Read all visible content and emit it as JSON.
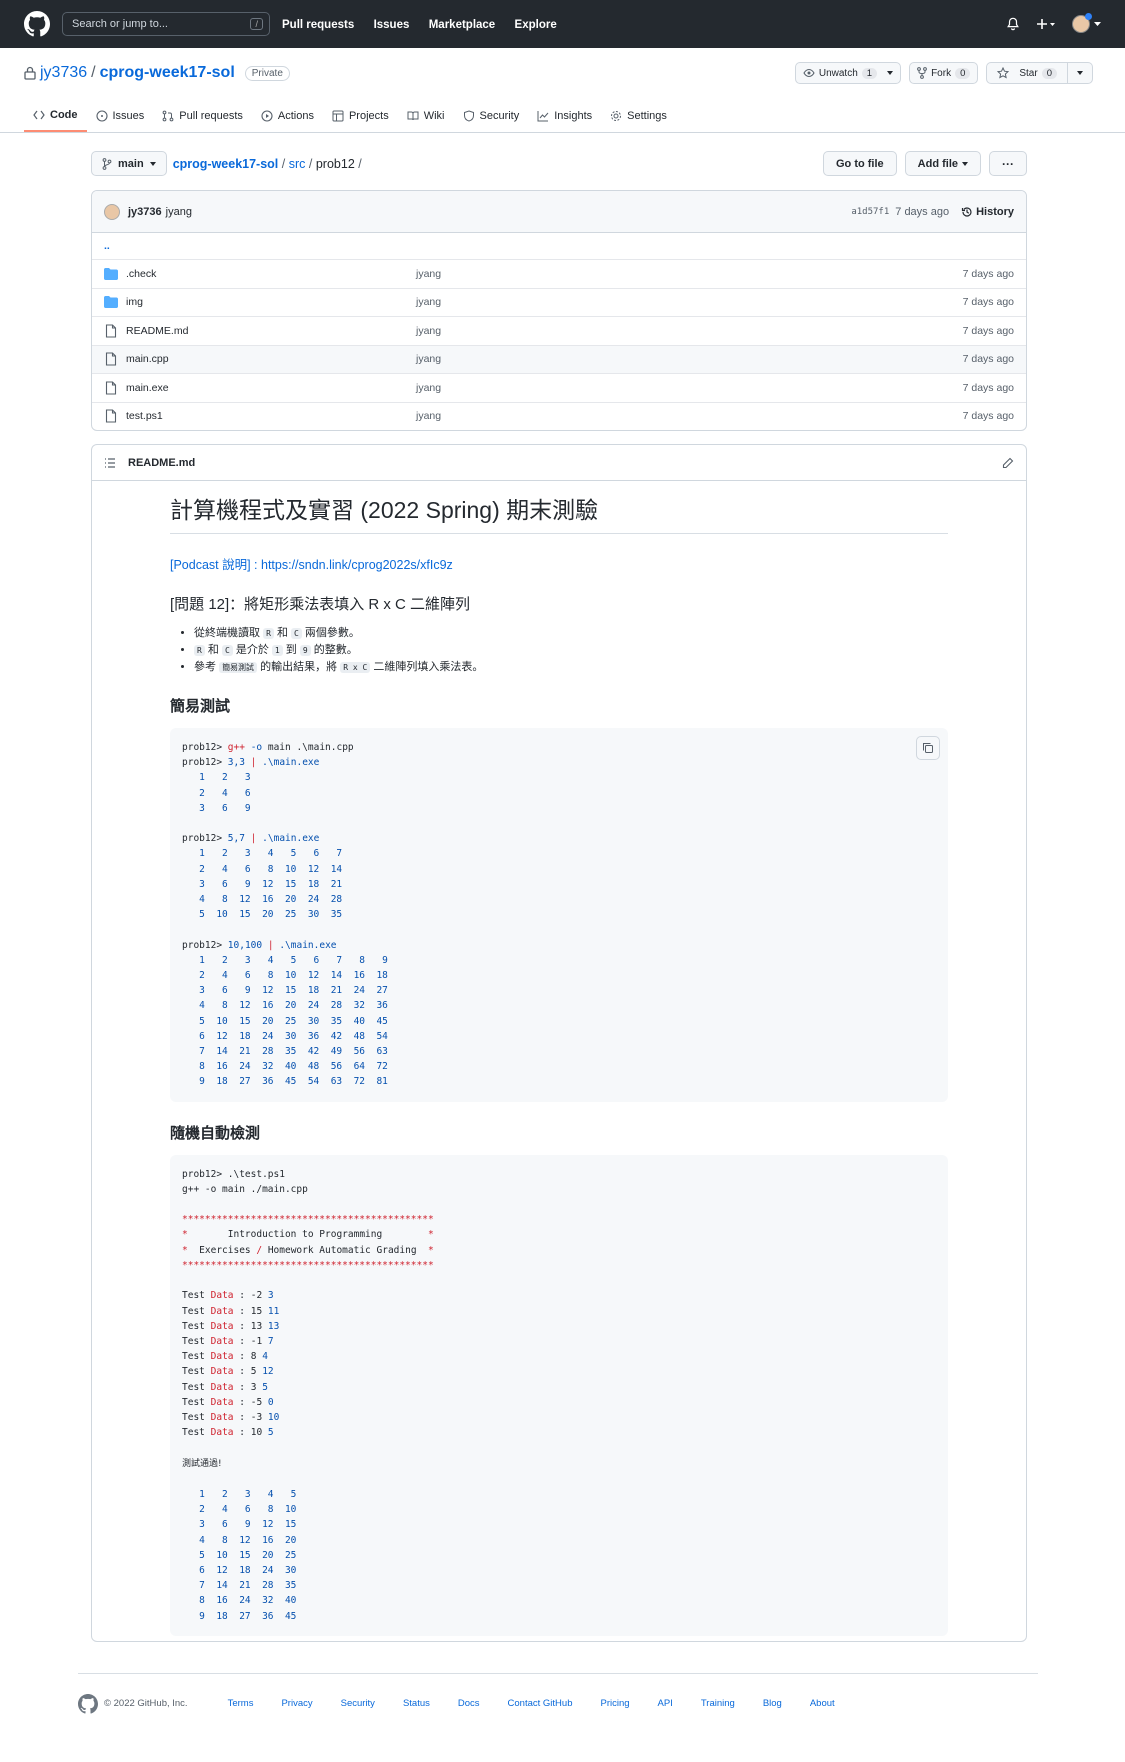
{
  "header": {
    "search_placeholder": "Search or jump to...",
    "slash_key": "/",
    "nav": [
      "Pull requests",
      "Issues",
      "Marketplace",
      "Explore"
    ]
  },
  "repo": {
    "owner": "jy3736",
    "separator": "/",
    "name": "cprog-week17-sol",
    "visibility": "Private",
    "unwatch_label": "Unwatch",
    "unwatch_count": "1",
    "fork_label": "Fork",
    "fork_count": "0",
    "star_label": "Star",
    "star_count": "0"
  },
  "tabs": [
    "Code",
    "Issues",
    "Pull requests",
    "Actions",
    "Projects",
    "Wiki",
    "Security",
    "Insights",
    "Settings"
  ],
  "path": {
    "branch": "main",
    "root": "cprog-week17-sol",
    "sep1": "/",
    "src": "src",
    "sep2": "/",
    "current": "prob12",
    "sep3": "/"
  },
  "buttons": {
    "go_to_file": "Go to file",
    "add_file": "Add file",
    "more": "···"
  },
  "commit": {
    "author": "jy3736",
    "committer": "jyang",
    "sha": "a1d57f1",
    "age": "7 days ago",
    "history": "History"
  },
  "files": {
    "parent": "..",
    "rows": [
      {
        "name": ".check",
        "type": "folder",
        "commit": "jyang",
        "age": "7 days ago"
      },
      {
        "name": "img",
        "type": "folder",
        "commit": "jyang",
        "age": "7 days ago"
      },
      {
        "name": "README.md",
        "type": "file",
        "commit": "jyang",
        "age": "7 days ago"
      },
      {
        "name": "main.cpp",
        "type": "file",
        "commit": "jyang",
        "age": "7 days ago"
      },
      {
        "name": "main.exe",
        "type": "file",
        "commit": "jyang",
        "age": "7 days ago"
      },
      {
        "name": "test.ps1",
        "type": "file",
        "commit": "jyang",
        "age": "7 days ago"
      }
    ]
  },
  "readme": {
    "filename": "README.md",
    "title": "計算機程式及實習 (2022 Spring) 期末測驗",
    "podcast": "[Podcast 說明] : https://sndn.link/cprog2022s/xfIc9z",
    "problem": "[問題 12]：將矩形乘法表填入 R x C 二維陣列",
    "bullet1": {
      "a": "從終端機讀取",
      "c1": "R",
      "b": "和",
      "c2": "C",
      "d": "兩個參數。"
    },
    "bullet2": {
      "c1": "R",
      "a": "和",
      "c2": "C",
      "b": "是介於",
      "c3": "1",
      "c": "到",
      "c4": "9",
      "d": "的整數。"
    },
    "bullet3": {
      "a": "參考",
      "c1": "簡易測試",
      "b": "的輸出結果，將",
      "c2": "R x C",
      "c": "二維陣列填入乘法表。"
    },
    "section1": "簡易測試",
    "section2": "隨機自動檢測"
  },
  "code1": {
    "prompt": "prob12>",
    "cmd1_rest": "g++ -o main .\\main.cpp",
    "runs": [
      {
        "args": "3,3",
        "pipe": "|",
        "exe": ".\\main.exe",
        "table": "   1   2   3\n   2   4   6\n   3   6   9"
      },
      {
        "args": "5,7",
        "pipe": "|",
        "exe": ".\\main.exe",
        "table": "   1   2   3   4   5   6   7\n   2   4   6   8  10  12  14\n   3   6   9  12  15  18  21\n   4   8  12  16  20  24  28\n   5  10  15  20  25  30  35"
      },
      {
        "args": "10,100",
        "pipe": "|",
        "exe": ".\\main.exe",
        "table": "   1   2   3   4   5   6   7   8   9\n   2   4   6   8  10  12  14  16  18\n   3   6   9  12  15  18  21  24  27\n   4   8  12  16  20  24  28  32  36\n   5  10  15  20  25  30  35  40  45\n   6  12  18  24  30  36  42  48  54\n   7  14  21  28  35  42  49  56  63\n   8  16  24  32  40  48  56  64  72\n   9  18  27  36  45  54  63  72  81"
      }
    ]
  },
  "code2": {
    "line1": "prob12> .\\test.ps1",
    "line2": "g++ -o main ./main.cpp",
    "banner_border": "********************************************",
    "banner_line1": "*       Introduction to Programming        *",
    "banner_line2a": "*  Exercises ",
    "banner_slash": "/",
    "banner_line2b": " Homework Automatic Grading  *",
    "tests": [
      [
        "-2",
        "3"
      ],
      [
        "15",
        "11"
      ],
      [
        "13",
        "13"
      ],
      [
        "-1",
        "7"
      ],
      [
        "8",
        "4"
      ],
      [
        "5",
        "12"
      ],
      [
        "3",
        "5"
      ],
      [
        "-5",
        "0"
      ],
      [
        "-3",
        "10"
      ],
      [
        "10",
        "5"
      ]
    ],
    "test_word": "Test",
    "data_word": "Data",
    "colon": ":",
    "pass": "測試通過!",
    "table": "   1   2   3   4   5\n   2   4   6   8  10\n   3   6   9  12  15\n   4   8  12  16  20\n   5  10  15  20  25\n   6  12  18  24  30\n   7  14  21  28  35\n   8  16  24  32  40\n   9  18  27  36  45"
  },
  "footer": {
    "copyright": "© 2022 GitHub, Inc.",
    "links": [
      "Terms",
      "Privacy",
      "Security",
      "Status",
      "Docs",
      "Contact GitHub",
      "Pricing",
      "API",
      "Training",
      "Blog",
      "About"
    ]
  },
  "colors": {
    "header_bg": "#24292f",
    "link": "#0969da",
    "folder": "#54aeff",
    "tab_underline": "#fd8c73"
  }
}
